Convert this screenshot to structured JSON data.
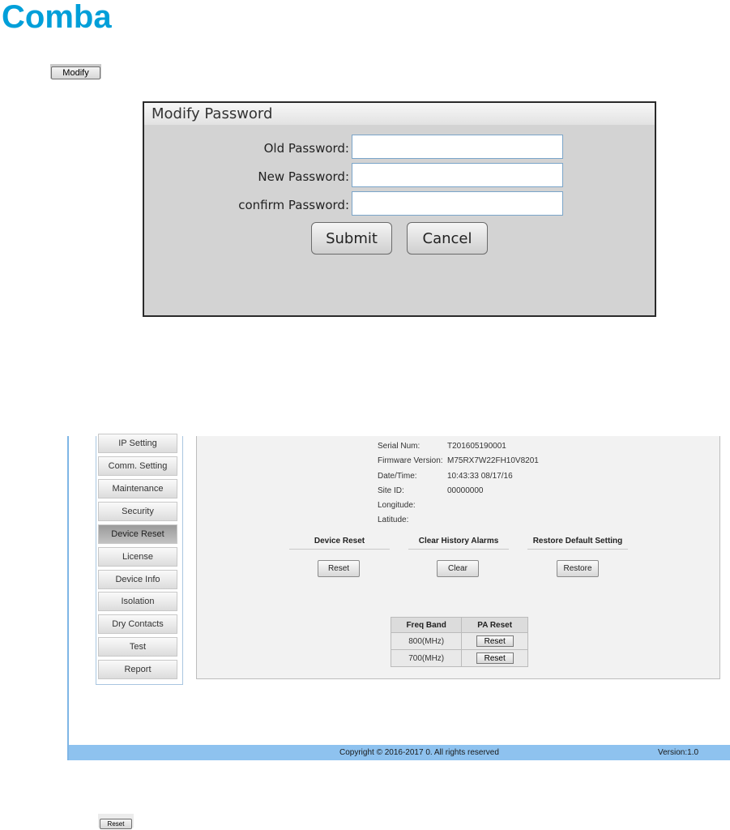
{
  "logo": {
    "text": "Comba",
    "color": "#009fd9"
  },
  "modify_button": {
    "label": "Modify"
  },
  "dialog": {
    "title": "Modify Password",
    "fields": [
      {
        "label": "Old Password:",
        "value": ""
      },
      {
        "label": "New Password:",
        "value": ""
      },
      {
        "label": "confirm Password:",
        "value": ""
      }
    ],
    "submit_label": "Submit",
    "cancel_label": "Cancel"
  },
  "device": {
    "sidebar": [
      {
        "label": "IP Setting",
        "active": false
      },
      {
        "label": "Comm. Setting",
        "active": false
      },
      {
        "label": "Maintenance",
        "active": false
      },
      {
        "label": "Security",
        "active": false
      },
      {
        "label": "Device Reset",
        "active": true
      },
      {
        "label": "License",
        "active": false
      },
      {
        "label": "Device Info",
        "active": false
      },
      {
        "label": "Isolation",
        "active": false
      },
      {
        "label": "Dry Contacts",
        "active": false
      },
      {
        "label": "Test",
        "active": false
      },
      {
        "label": "Report",
        "active": false
      }
    ],
    "info": [
      {
        "label": "Serial Num:",
        "value": "T201605190001"
      },
      {
        "label": "Firmware Version:",
        "value": "M75RX7W22FH10V8201"
      },
      {
        "label": "Date/Time:",
        "value": "10:43:33 08/17/16"
      },
      {
        "label": "Site ID:",
        "value": "00000000"
      },
      {
        "label": "Longitude:",
        "value": ""
      },
      {
        "label": "Latitude:",
        "value": ""
      }
    ],
    "sections": [
      {
        "heading": "Device Reset",
        "button": "Reset"
      },
      {
        "heading": "Clear History Alarms",
        "button": "Clear"
      },
      {
        "heading": "Restore Default Setting",
        "button": "Restore"
      }
    ],
    "pa_table": {
      "headers": [
        "Freq Band",
        "PA Reset"
      ],
      "rows": [
        {
          "band": "800(MHz)",
          "button": "Reset"
        },
        {
          "band": "700(MHz)",
          "button": "Reset"
        }
      ]
    },
    "footer": {
      "copyright": "Copyright © 2016-2017 0. All rights reserved",
      "version": "Version:1.0"
    }
  },
  "bottom_reset_button": {
    "label": "Reset"
  }
}
